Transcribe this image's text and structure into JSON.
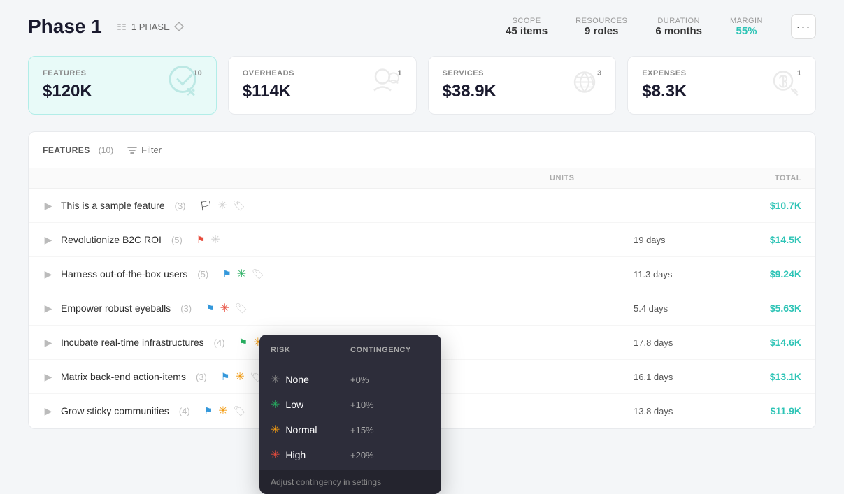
{
  "header": {
    "title": "Phase 1",
    "phase_badge": "1 PHASE",
    "stats": {
      "scope_label": "SCOPE",
      "scope_value": "45 items",
      "resources_label": "RESOURCES",
      "resources_value": "9 roles",
      "duration_label": "DURATION",
      "duration_value": "6 months",
      "margin_label": "MARGIN",
      "margin_value": "55%"
    },
    "more_btn": "···"
  },
  "cards": [
    {
      "label": "FEATURES",
      "count": "10",
      "amount": "$120K",
      "active": true
    },
    {
      "label": "OVERHEADS",
      "count": "1",
      "amount": "$114K",
      "active": false
    },
    {
      "label": "SERVICES",
      "count": "3",
      "amount": "$38.9K",
      "active": false
    },
    {
      "label": "EXPENSES",
      "count": "1",
      "amount": "$8.3K",
      "active": false
    }
  ],
  "table": {
    "section_label": "FEATURES",
    "section_count": "(10)",
    "filter_label": "Filter",
    "col_headers": [
      "",
      "UNITS",
      "",
      "",
      "TOTAL"
    ],
    "rows": [
      {
        "name": "This is a sample feature",
        "count": "(3)",
        "flag": "none",
        "risk": "gray",
        "days": "",
        "total": ""
      },
      {
        "name": "Revolutionize B2C ROI",
        "count": "(5)",
        "flag": "red",
        "risk": "gray",
        "days": "19 days",
        "total": "$14.5K"
      },
      {
        "name": "Harness out-of-the-box users",
        "count": "(5)",
        "flag": "blue",
        "risk": "green",
        "days": "11.3 days",
        "total": "$9.24K"
      },
      {
        "name": "Empower robust eyeballs",
        "count": "(3)",
        "flag": "blue",
        "risk": "red",
        "days": "5.4 days",
        "total": "$5.63K"
      },
      {
        "name": "Incubate real-time infrastructures",
        "count": "(4)",
        "flag": "green",
        "risk": "orange",
        "days": "17.8 days",
        "total": "$14.6K"
      },
      {
        "name": "Matrix back-end action-items",
        "count": "(3)",
        "flag": "blue",
        "risk": "orange",
        "days": "16.1 days",
        "total": "$13.1K"
      },
      {
        "name": "Grow sticky communities",
        "count": "(4)",
        "flag": "blue",
        "risk": "orange",
        "days": "13.8 days",
        "total": "$11.9K"
      }
    ]
  },
  "dropdown": {
    "risk_col_header": "RISK",
    "contingency_col_header": "CONTINGENCY",
    "options": [
      {
        "label": "None",
        "contingency": "+0%",
        "star_class": "none"
      },
      {
        "label": "Low",
        "contingency": "+10%",
        "star_class": "low"
      },
      {
        "label": "Normal",
        "contingency": "+15%",
        "star_class": "normal"
      },
      {
        "label": "High",
        "contingency": "+20%",
        "star_class": "high"
      }
    ],
    "footer_text": "Adjust contingency in settings"
  }
}
